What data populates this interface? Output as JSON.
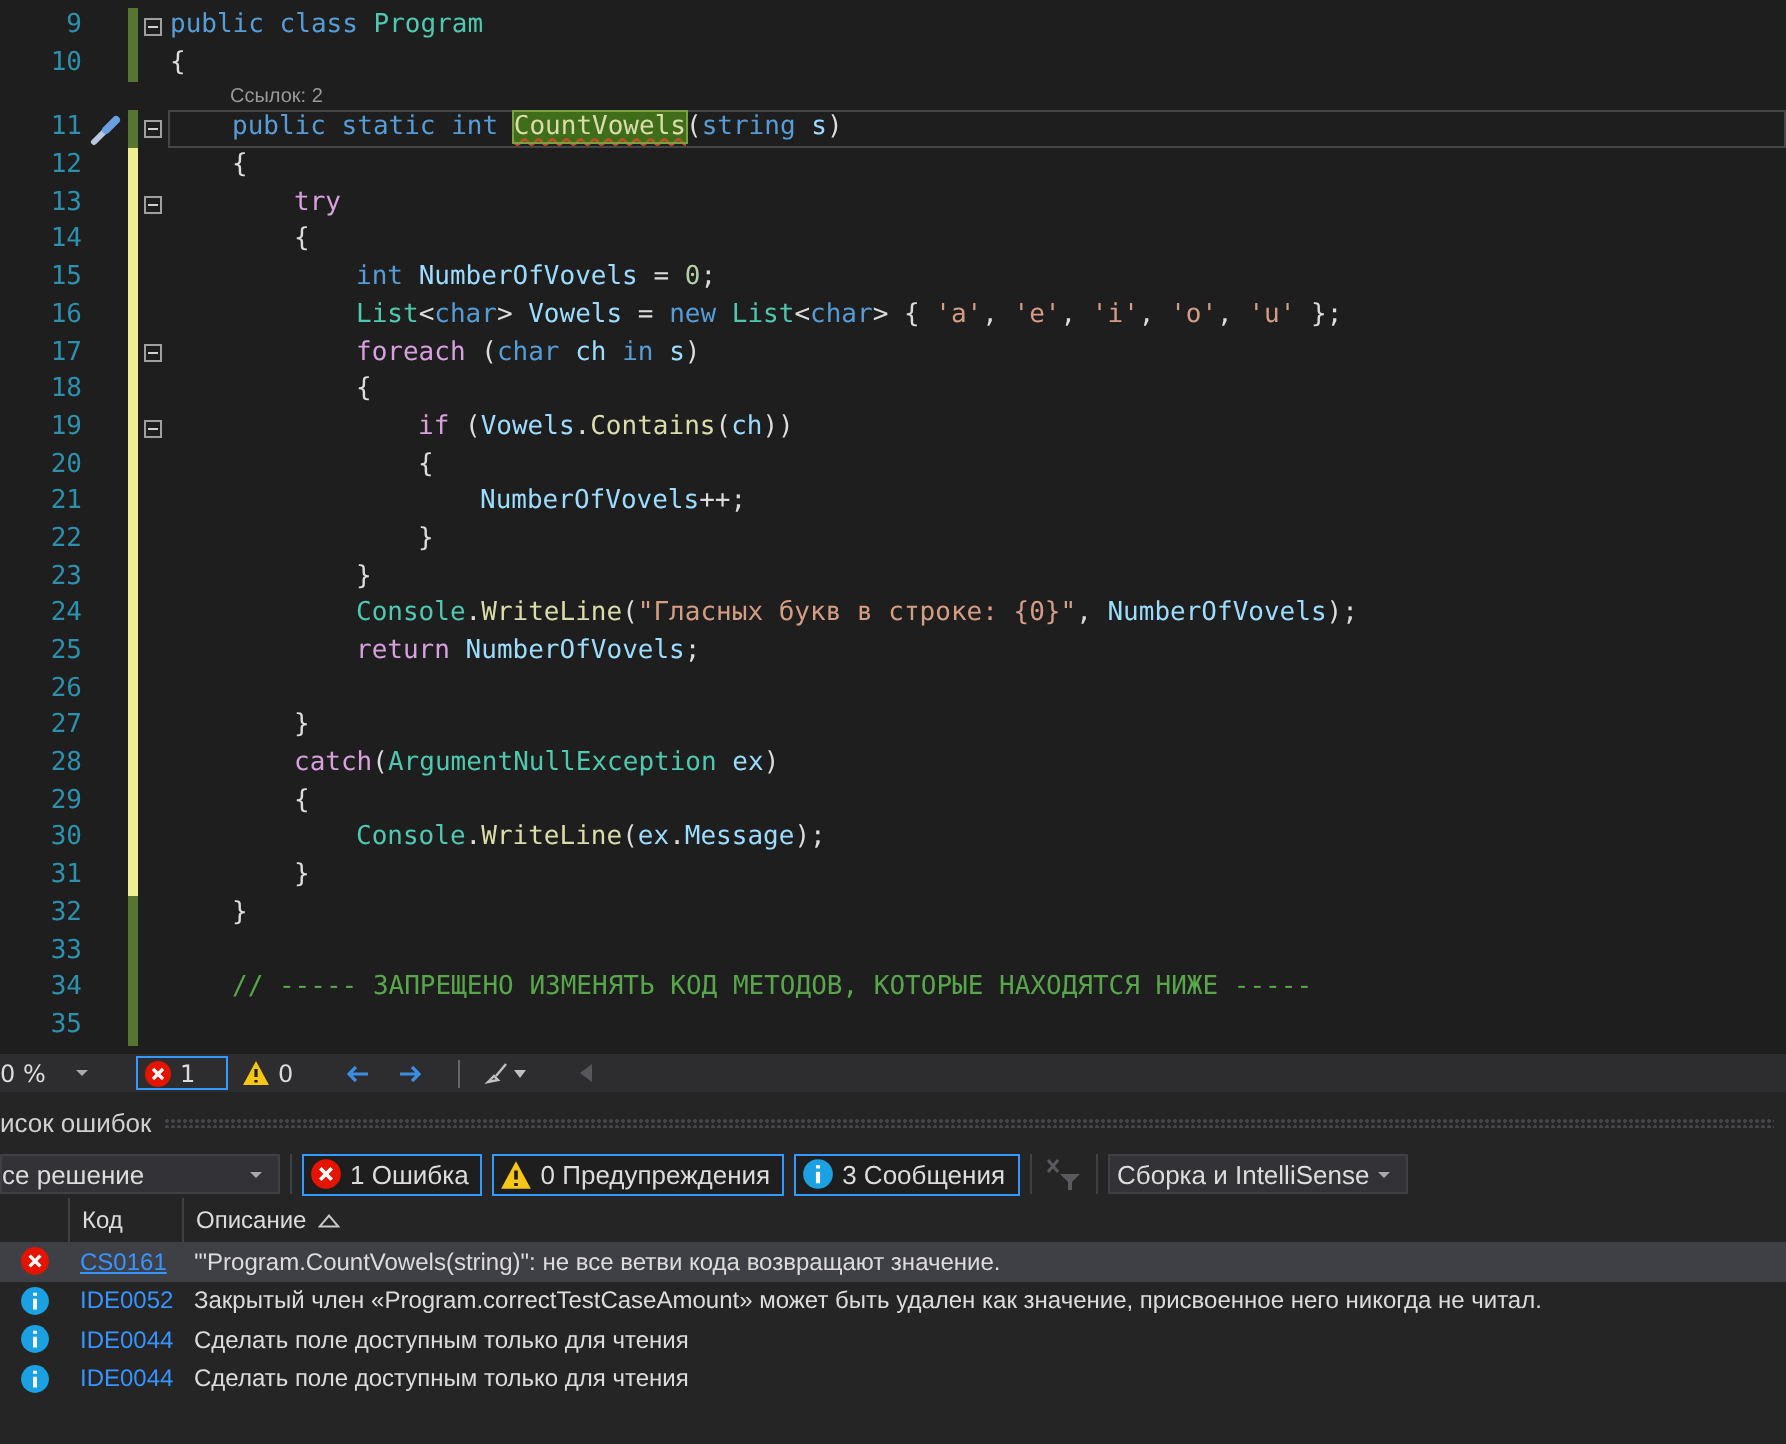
{
  "editor": {
    "lines": [
      {
        "number": "9",
        "saved": true,
        "fold": true,
        "current": false,
        "quick_action": false,
        "tokens": [
          {
            "text": "public ",
            "kind": "kw"
          },
          {
            "text": "class ",
            "kind": "kw"
          },
          {
            "text": "Program",
            "kind": "type"
          }
        ]
      },
      {
        "number": "10",
        "saved": true,
        "fold": false,
        "current": false,
        "quick_action": false,
        "tokens": [
          {
            "text": "{",
            "kind": "plain"
          }
        ],
        "children": [
          {
            "number": "11",
            "saved": true,
            "fold": true,
            "current": true,
            "quick_action": true,
            "codelens": "Ссылок: 2",
            "tokens": [
              {
                "text": "public static int ",
                "kind": "kw"
              },
              {
                "text": "CountVowels",
                "kind": "method",
                "highlighted": true
              },
              {
                "text": "(",
                "kind": "plain"
              },
              {
                "text": "string ",
                "kind": "kw"
              },
              {
                "text": "s",
                "kind": "ident"
              },
              {
                "text": ")",
                "kind": "plain"
              }
            ]
          },
          {
            "number": "12",
            "saved": false,
            "fold": false,
            "current": false,
            "quick_action": false,
            "tokens": [
              {
                "text": "{",
                "kind": "plain"
              }
            ],
            "children": [
              {
                "number": "13",
                "saved": false,
                "fold": true,
                "current": false,
                "quick_action": false,
                "tokens": [
                  {
                    "text": "try",
                    "kind": "ctrl"
                  }
                ]
              },
              {
                "number": "14",
                "saved": false,
                "fold": false,
                "current": false,
                "quick_action": false,
                "tokens": [
                  {
                    "text": "{",
                    "kind": "plain"
                  }
                ],
                "children": [
                  {
                    "number": "15",
                    "saved": false,
                    "fold": false,
                    "current": false,
                    "quick_action": false,
                    "tokens": [
                      {
                        "text": "int ",
                        "kind": "kw"
                      },
                      {
                        "text": "NumberOfVovels",
                        "kind": "ident"
                      },
                      {
                        "text": " = ",
                        "kind": "plain"
                      },
                      {
                        "text": "0",
                        "kind": "num"
                      },
                      {
                        "text": ";",
                        "kind": "plain"
                      }
                    ]
                  },
                  {
                    "number": "16",
                    "saved": false,
                    "fold": false,
                    "current": false,
                    "quick_action": false,
                    "tokens": [
                      {
                        "text": "List",
                        "kind": "type"
                      },
                      {
                        "text": "<",
                        "kind": "plain"
                      },
                      {
                        "text": "char",
                        "kind": "kw"
                      },
                      {
                        "text": "> ",
                        "kind": "plain"
                      },
                      {
                        "text": "Vowels",
                        "kind": "ident"
                      },
                      {
                        "text": " = ",
                        "kind": "plain"
                      },
                      {
                        "text": "new ",
                        "kind": "kw"
                      },
                      {
                        "text": "List",
                        "kind": "type"
                      },
                      {
                        "text": "<",
                        "kind": "plain"
                      },
                      {
                        "text": "char",
                        "kind": "kw"
                      },
                      {
                        "text": "> { ",
                        "kind": "plain"
                      },
                      {
                        "text": "'a'",
                        "kind": "str"
                      },
                      {
                        "text": ", ",
                        "kind": "plain"
                      },
                      {
                        "text": "'e'",
                        "kind": "str"
                      },
                      {
                        "text": ", ",
                        "kind": "plain"
                      },
                      {
                        "text": "'i'",
                        "kind": "str"
                      },
                      {
                        "text": ", ",
                        "kind": "plain"
                      },
                      {
                        "text": "'o'",
                        "kind": "str"
                      },
                      {
                        "text": ", ",
                        "kind": "plain"
                      },
                      {
                        "text": "'u'",
                        "kind": "str"
                      },
                      {
                        "text": " };",
                        "kind": "plain"
                      }
                    ]
                  },
                  {
                    "number": "17",
                    "saved": false,
                    "fold": true,
                    "current": false,
                    "quick_action": false,
                    "tokens": [
                      {
                        "text": "foreach ",
                        "kind": "ctrl"
                      },
                      {
                        "text": "(",
                        "kind": "plain"
                      },
                      {
                        "text": "char ",
                        "kind": "kw"
                      },
                      {
                        "text": "ch ",
                        "kind": "ident"
                      },
                      {
                        "text": "in ",
                        "kind": "kw"
                      },
                      {
                        "text": "s",
                        "kind": "ident"
                      },
                      {
                        "text": ")",
                        "kind": "plain"
                      }
                    ]
                  },
                  {
                    "number": "18",
                    "saved": false,
                    "fold": false,
                    "current": false,
                    "quick_action": false,
                    "tokens": [
                      {
                        "text": "{",
                        "kind": "plain"
                      }
                    ],
                    "children": [
                      {
                        "number": "19",
                        "saved": false,
                        "fold": true,
                        "current": false,
                        "quick_action": false,
                        "tokens": [
                          {
                            "text": "if ",
                            "kind": "ctrl"
                          },
                          {
                            "text": "(",
                            "kind": "plain"
                          },
                          {
                            "text": "Vowels",
                            "kind": "ident"
                          },
                          {
                            "text": ".",
                            "kind": "plain"
                          },
                          {
                            "text": "Contains",
                            "kind": "method"
                          },
                          {
                            "text": "(",
                            "kind": "plain"
                          },
                          {
                            "text": "ch",
                            "kind": "ident"
                          },
                          {
                            "text": "))",
                            "kind": "plain"
                          }
                        ]
                      },
                      {
                        "number": "20",
                        "saved": false,
                        "fold": false,
                        "current": false,
                        "quick_action": false,
                        "tokens": [
                          {
                            "text": "{",
                            "kind": "plain"
                          }
                        ],
                        "children": [
                          {
                            "number": "21",
                            "saved": false,
                            "fold": false,
                            "current": false,
                            "quick_action": false,
                            "tokens": [
                              {
                                "text": "NumberOfVovels",
                                "kind": "ident"
                              },
                              {
                                "text": "++;",
                                "kind": "plain"
                              }
                            ]
                          }
                        ]
                      },
                      {
                        "number": "22",
                        "saved": false,
                        "fold": false,
                        "current": false,
                        "quick_action": false,
                        "tokens": [
                          {
                            "text": "}",
                            "kind": "plain"
                          }
                        ]
                      }
                    ]
                  },
                  {
                    "number": "23",
                    "saved": false,
                    "fold": false,
                    "current": false,
                    "quick_action": false,
                    "tokens": [
                      {
                        "text": "}",
                        "kind": "plain"
                      }
                    ]
                  },
                  {
                    "number": "24",
                    "saved": false,
                    "fold": false,
                    "current": false,
                    "quick_action": false,
                    "tokens": [
                      {
                        "text": "Console",
                        "kind": "type"
                      },
                      {
                        "text": ".",
                        "kind": "plain"
                      },
                      {
                        "text": "WriteLine",
                        "kind": "method"
                      },
                      {
                        "text": "(",
                        "kind": "plain"
                      },
                      {
                        "text": "\"Гласных букв в строке: {0}\"",
                        "kind": "str"
                      },
                      {
                        "text": ", ",
                        "kind": "plain"
                      },
                      {
                        "text": "NumberOfVovels",
                        "kind": "ident"
                      },
                      {
                        "text": ");",
                        "kind": "plain"
                      }
                    ]
                  },
                  {
                    "number": "25",
                    "saved": false,
                    "fold": false,
                    "current": false,
                    "quick_action": false,
                    "tokens": [
                      {
                        "text": "return ",
                        "kind": "ctrl"
                      },
                      {
                        "text": "NumberOfVovels",
                        "kind": "ident"
                      },
                      {
                        "text": ";",
                        "kind": "plain"
                      }
                    ]
                  },
                  {
                    "number": "26",
                    "saved": false,
                    "fold": false,
                    "current": false,
                    "quick_action": false
                  }
                ]
              },
              {
                "number": "27",
                "saved": false,
                "fold": false,
                "current": false,
                "quick_action": false,
                "tokens": [
                  {
                    "text": "}",
                    "kind": "plain"
                  }
                ]
              },
              {
                "number": "28",
                "saved": false,
                "fold": false,
                "current": false,
                "quick_action": false,
                "tokens": [
                  {
                    "text": "catch",
                    "kind": "ctrl"
                  },
                  {
                    "text": "(",
                    "kind": "plain"
                  },
                  {
                    "text": "ArgumentNullException ",
                    "kind": "type"
                  },
                  {
                    "text": "ex",
                    "kind": "ident"
                  },
                  {
                    "text": ")",
                    "kind": "plain"
                  }
                ]
              },
              {
                "number": "29",
                "saved": false,
                "fold": false,
                "current": false,
                "quick_action": false,
                "tokens": [
                  {
                    "text": "{",
                    "kind": "plain"
                  }
                ],
                "children": [
                  {
                    "number": "30",
                    "saved": false,
                    "fold": false,
                    "current": false,
                    "quick_action": false,
                    "tokens": [
                      {
                        "text": "Console",
                        "kind": "type"
                      },
                      {
                        "text": ".",
                        "kind": "plain"
                      },
                      {
                        "text": "WriteLine",
                        "kind": "method"
                      },
                      {
                        "text": "(",
                        "kind": "plain"
                      },
                      {
                        "text": "ex",
                        "kind": "ident"
                      },
                      {
                        "text": ".",
                        "kind": "plain"
                      },
                      {
                        "text": "Message",
                        "kind": "ident"
                      },
                      {
                        "text": ");",
                        "kind": "plain"
                      }
                    ]
                  }
                ]
              },
              {
                "number": "31",
                "saved": false,
                "fold": false,
                "current": false,
                "quick_action": false,
                "tokens": [
                  {
                    "text": "}",
                    "kind": "plain"
                  }
                ]
              }
            ]
          },
          {
            "number": "32",
            "saved": true,
            "fold": false,
            "current": false,
            "quick_action": false,
            "tokens": [
              {
                "text": "}",
                "kind": "plain"
              }
            ]
          },
          {
            "number": "33",
            "saved": true,
            "fold": false,
            "current": false,
            "quick_action": false
          },
          {
            "number": "34",
            "saved": true,
            "fold": false,
            "current": false,
            "quick_action": false,
            "tokens": [
              {
                "text": "// ----- ЗАПРЕЩЕНО ИЗМЕНЯТЬ КОД МЕТОДОВ, КОТОРЫЕ НАХОДЯТСЯ НИЖЕ -----",
                "kind": "comment"
              }
            ]
          },
          {
            "number": "35",
            "saved": true,
            "fold": false,
            "current": false,
            "quick_action": false
          }
        ]
      }
    ]
  },
  "status_bar": {
    "zoom": "0 %",
    "errors": "1",
    "warnings": "0"
  },
  "error_list": {
    "title": "исок ошибок",
    "scope": "се решение",
    "filters": [
      {
        "kind": "error",
        "label": "1 Ошибка",
        "selected": true
      },
      {
        "kind": "warning",
        "label": "0 Предупреждения",
        "selected": true
      },
      {
        "kind": "info",
        "label": "3 Сообщения",
        "selected": true
      }
    ],
    "source": "Сборка и IntelliSense",
    "columns": [
      "Код",
      "Описание"
    ],
    "rows": [
      {
        "kind": "error",
        "code": "CS0161",
        "description": "'\"Program.CountVowels(string)\": не все ветви кода возвращают значение.",
        "selected": true
      },
      {
        "kind": "info",
        "code": "IDE0052",
        "description": "Закрытый член «Program.correctTestCaseAmount» может быть удален как значение, присвоенное него никогда не читал.",
        "selected": false
      },
      {
        "kind": "info",
        "code": "IDE0044",
        "description": "Сделать поле доступным только для чтения",
        "selected": false
      },
      {
        "kind": "info",
        "code": "IDE0044",
        "description": "Сделать поле доступным только для чтения",
        "selected": false
      }
    ]
  }
}
